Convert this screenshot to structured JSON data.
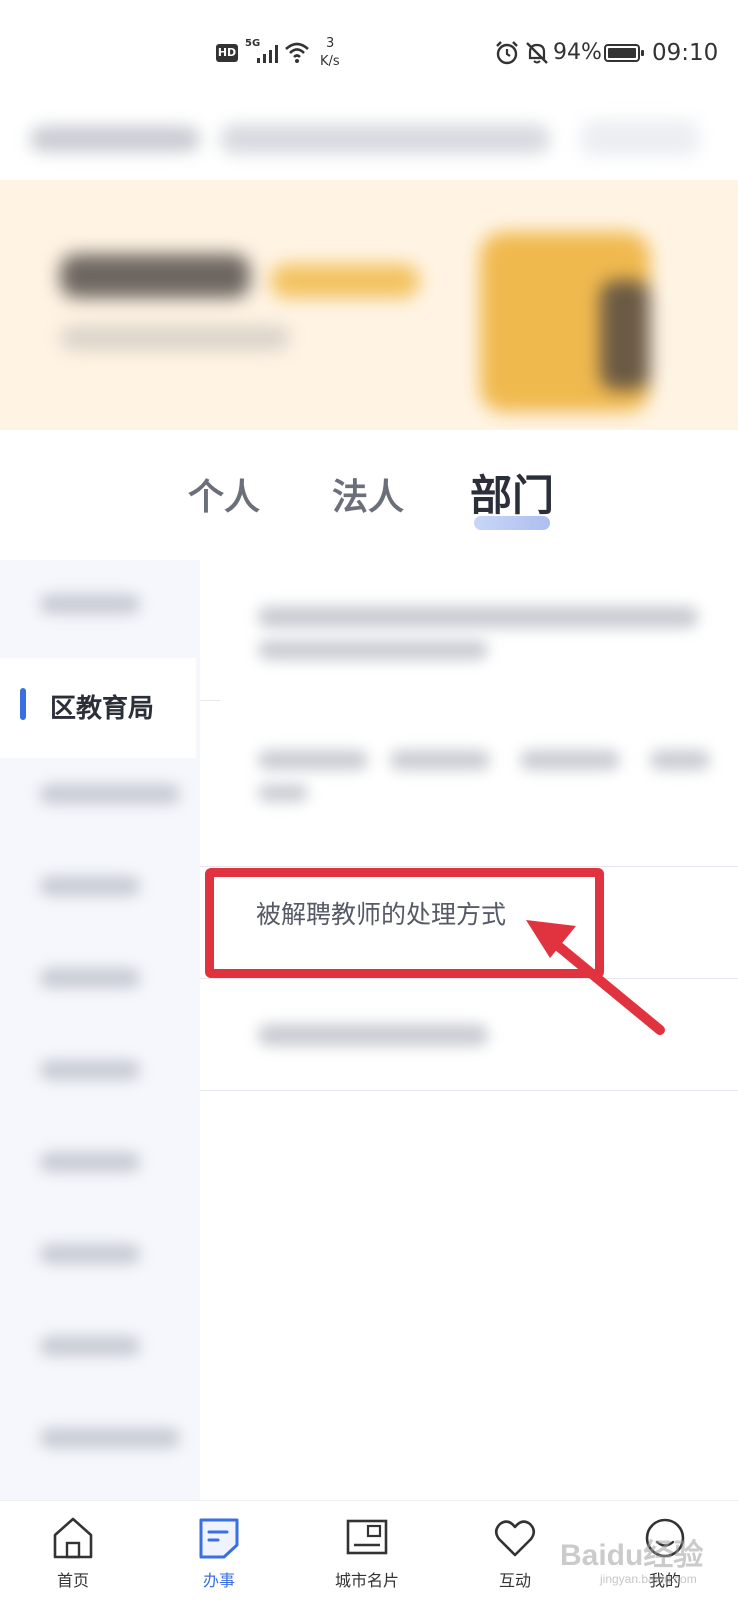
{
  "status_bar": {
    "hd": "HD",
    "network": "5G",
    "speed_value": "3",
    "speed_unit": "K/s",
    "battery": "94%",
    "time": "09:10"
  },
  "tabs": [
    {
      "label": "个人",
      "active": false
    },
    {
      "label": "法人",
      "active": false
    },
    {
      "label": "部门",
      "active": true
    }
  ],
  "sidebar": {
    "active_item": "区教育局"
  },
  "content": {
    "highlighted_item": "被解聘教师的处理方式"
  },
  "bottom_nav": [
    {
      "label": "首页",
      "icon": "home-icon",
      "active": false
    },
    {
      "label": "办事",
      "icon": "document-icon",
      "active": true
    },
    {
      "label": "城市名片",
      "icon": "postcard-icon",
      "active": false
    },
    {
      "label": "互动",
      "icon": "heart-icon",
      "active": false
    },
    {
      "label": "我的",
      "icon": "user-icon",
      "active": false
    }
  ],
  "colors": {
    "accent": "#3a6fe0",
    "annotation": "#e0333f"
  },
  "watermark": {
    "text": "Baidu经验",
    "sub": "jingyan.baidu.com"
  }
}
